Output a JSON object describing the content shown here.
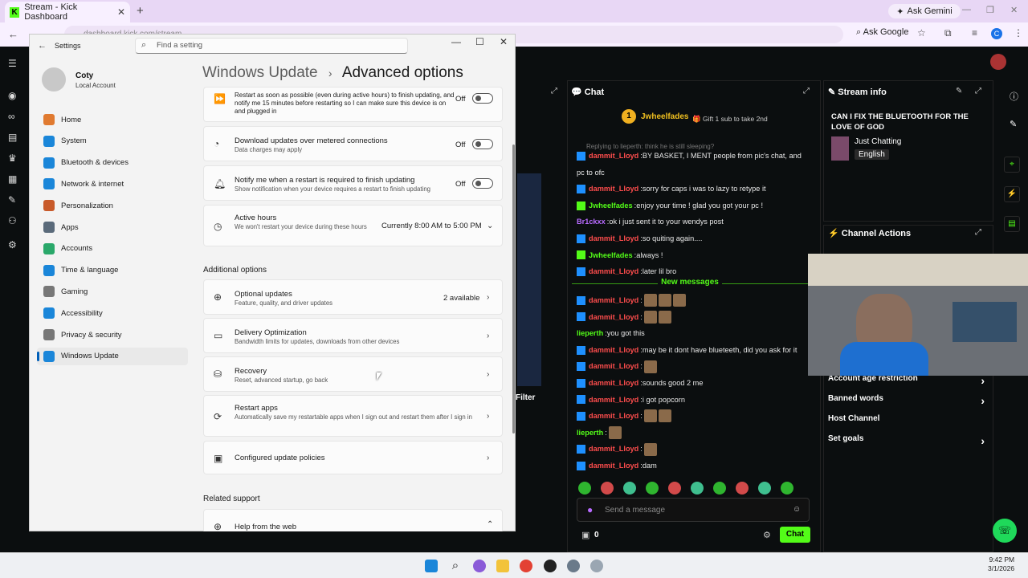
{
  "browser": {
    "tab_title": "Stream - Kick Dashboard",
    "tab_favicon": "K",
    "url": "dashboard.kick.com/stream",
    "ask_gemini": "Ask Gemini",
    "ask_google": "Ask Google",
    "profile_initial": "C"
  },
  "settings": {
    "window_title": "Settings",
    "search_placeholder": "Find a setting",
    "user_name": "Coty",
    "user_type": "Local Account",
    "nav": [
      {
        "label": "Home",
        "icon": "home-icon",
        "color": "#e07a30"
      },
      {
        "label": "System",
        "icon": "monitor-icon",
        "color": "#1a86d9"
      },
      {
        "label": "Bluetooth & devices",
        "icon": "bluetooth-icon",
        "color": "#1a86d9"
      },
      {
        "label": "Network & internet",
        "icon": "network-icon",
        "color": "#1a86d9"
      },
      {
        "label": "Personalization",
        "icon": "brush-icon",
        "color": "#c85a2a"
      },
      {
        "label": "Apps",
        "icon": "apps-icon",
        "color": "#5a6a7a"
      },
      {
        "label": "Accounts",
        "icon": "accounts-icon",
        "color": "#2aa86a"
      },
      {
        "label": "Time & language",
        "icon": "globe-icon",
        "color": "#1a86d9"
      },
      {
        "label": "Gaming",
        "icon": "gamepad-icon",
        "color": "#777777"
      },
      {
        "label": "Accessibility",
        "icon": "accessibility-icon",
        "color": "#1a86d9"
      },
      {
        "label": "Privacy & security",
        "icon": "shield-icon",
        "color": "#777777"
      },
      {
        "label": "Windows Update",
        "icon": "update-icon",
        "color": "#1a86d9"
      }
    ],
    "breadcrumb_parent": "Windows Update",
    "breadcrumb_sep": "›",
    "breadcrumb_current": "Advanced options",
    "restart_desc": "Restart as soon as possible (even during active hours) to finish updating, and notify me 15 minutes before restarting so I can make sure this device is on and plugged in",
    "restart_state": "Off",
    "metered_title": "Download updates over metered connections",
    "metered_sub": "Data charges may apply",
    "metered_state": "Off",
    "notify_title": "Notify me when a restart is required to finish updating",
    "notify_sub": "Show notification when your device requires a restart to finish updating",
    "notify_state": "Off",
    "active_title": "Active hours",
    "active_sub": "We won't restart your device during these hours",
    "active_value": "Currently 8:00 AM to 5:00 PM",
    "additional_header": "Additional options",
    "optional_title": "Optional updates",
    "optional_sub": "Feature, quality, and driver updates",
    "optional_value": "2 available",
    "delivery_title": "Delivery Optimization",
    "delivery_sub": "Bandwidth limits for updates, downloads from other devices",
    "recovery_title": "Recovery",
    "recovery_sub": "Reset, advanced startup, go back",
    "restartapps_title": "Restart apps",
    "restartapps_sub": "Automatically save my restartable apps when I sign out and restart them after I sign in",
    "policies_title": "Configured update policies",
    "related_header": "Related support",
    "help_title": "Help from the web"
  },
  "kick": {
    "chat_header": "Chat",
    "top_gifter": "Jwheelfades",
    "top_gifter_rank": "1",
    "gift_text": "Gift 1 sub to take 2nd",
    "reply_hint": "Replying to lieperth: think he is still sleeping?",
    "messages_before": [
      {
        "user": "dammit_Lloyd",
        "color": "red",
        "badge": "blue",
        "text": "BY BASKET, I MENT people from pic's chat, and"
      },
      {
        "user": "",
        "color": "white",
        "badge": "",
        "text": "pc to ofc"
      },
      {
        "user": "dammit_Lloyd",
        "color": "red",
        "badge": "blue",
        "text": "sorry for caps i was to lazy to retype it"
      },
      {
        "user": "Jwheelfades",
        "color": "green",
        "badge": "green",
        "text": "enjoy your time ! glad you got your pc !"
      },
      {
        "user": "Br1ckxx",
        "color": "purple",
        "badge": "",
        "text": "ok i just sent it to your wendys post"
      },
      {
        "user": "dammit_Lloyd",
        "color": "red",
        "badge": "blue",
        "text": "so quiting again...."
      },
      {
        "user": "Jwheelfades",
        "color": "green",
        "badge": "green",
        "text": "always !"
      },
      {
        "user": "dammit_Lloyd",
        "color": "red",
        "badge": "blue",
        "text": "later lil bro"
      }
    ],
    "new_messages": "New messages",
    "messages_after": [
      {
        "user": "dammit_Lloyd",
        "color": "red",
        "badge": "blue",
        "text": "",
        "emotes": 3
      },
      {
        "user": "dammit_Lloyd",
        "color": "red",
        "badge": "blue",
        "text": "",
        "emotes": 2
      },
      {
        "user": "lieperth",
        "color": "green",
        "badge": "",
        "text": "you got this",
        "emotes": 0
      },
      {
        "user": "dammit_Lloyd",
        "color": "red",
        "badge": "blue",
        "text": "may be it dont have blueteeth, did you ask for it",
        "emotes": 0
      },
      {
        "user": "dammit_Lloyd",
        "color": "red",
        "badge": "blue",
        "text": "",
        "emotes": 1
      },
      {
        "user": "dammit_Lloyd",
        "color": "red",
        "badge": "blue",
        "text": "sounds good 2 me",
        "emotes": 0
      },
      {
        "user": "dammit_Lloyd",
        "color": "red",
        "badge": "blue",
        "text": "i got popcorn",
        "emotes": 0
      },
      {
        "user": "dammit_Lloyd",
        "color": "red",
        "badge": "blue",
        "text": "",
        "emotes": 2
      },
      {
        "user": "lieperth",
        "color": "green",
        "badge": "",
        "text": "",
        "emotes": 1
      },
      {
        "user": "dammit_Lloyd",
        "color": "red",
        "badge": "blue",
        "text": "",
        "emotes": 1
      },
      {
        "user": "dammit_Lloyd",
        "color": "red",
        "badge": "blue",
        "text": "dam",
        "emotes": 0
      }
    ],
    "send_placeholder": "Send a message",
    "points": "0",
    "chat_button": "Chat",
    "stream_info_header": "Stream info",
    "stream_title": "CAN I FIX THE BLUETOOTH FOR THE LOVE OF GOD",
    "category": "Just Chatting",
    "language": "English",
    "channel_actions_header": "Channel Actions",
    "actions": [
      "Account age restriction",
      "Banned words",
      "Host Channel",
      "Set goals"
    ],
    "filter_label": "Filter",
    "accent": "#53fc18"
  },
  "taskbar": {
    "time": "9:42 PM",
    "date": "3/1/2026"
  }
}
